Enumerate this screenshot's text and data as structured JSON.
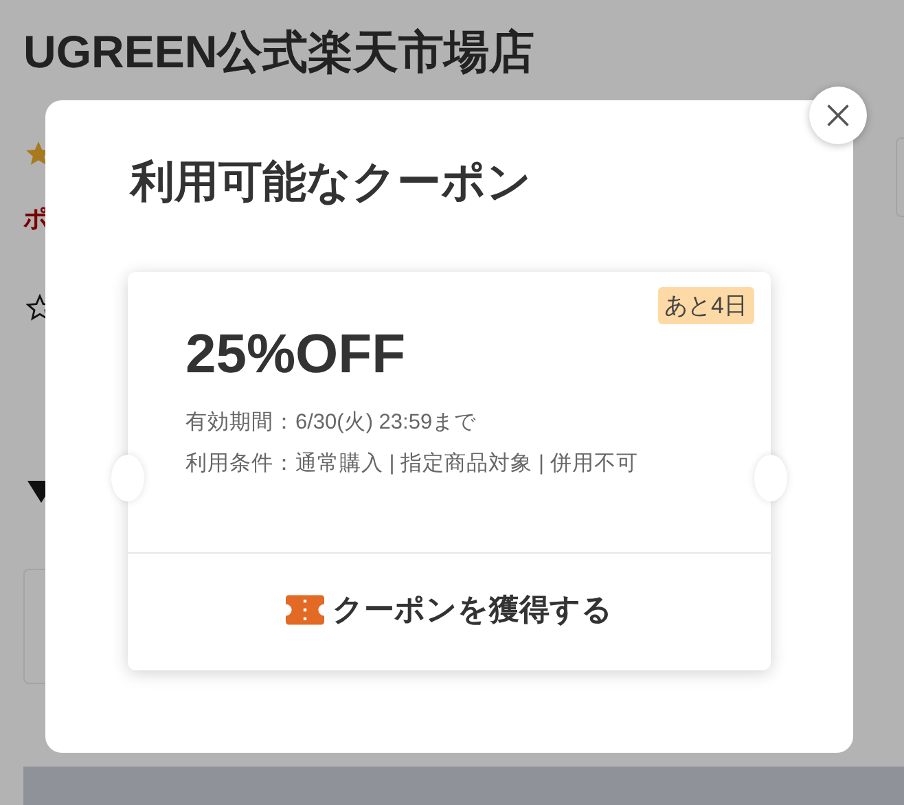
{
  "page": {
    "shop_title": "UGREEN公式楽天市場店",
    "points_label": "ポ"
  },
  "modal": {
    "title": "利用可能なクーポン",
    "coupon": {
      "discount": "25%OFF",
      "badge": "あと4日",
      "validity": "有効期間：6/30(火) 23:59まで",
      "conditions": "利用条件：通常購入 | 指定商品対象 | 併用不可",
      "action": "クーポンを獲得する"
    }
  }
}
